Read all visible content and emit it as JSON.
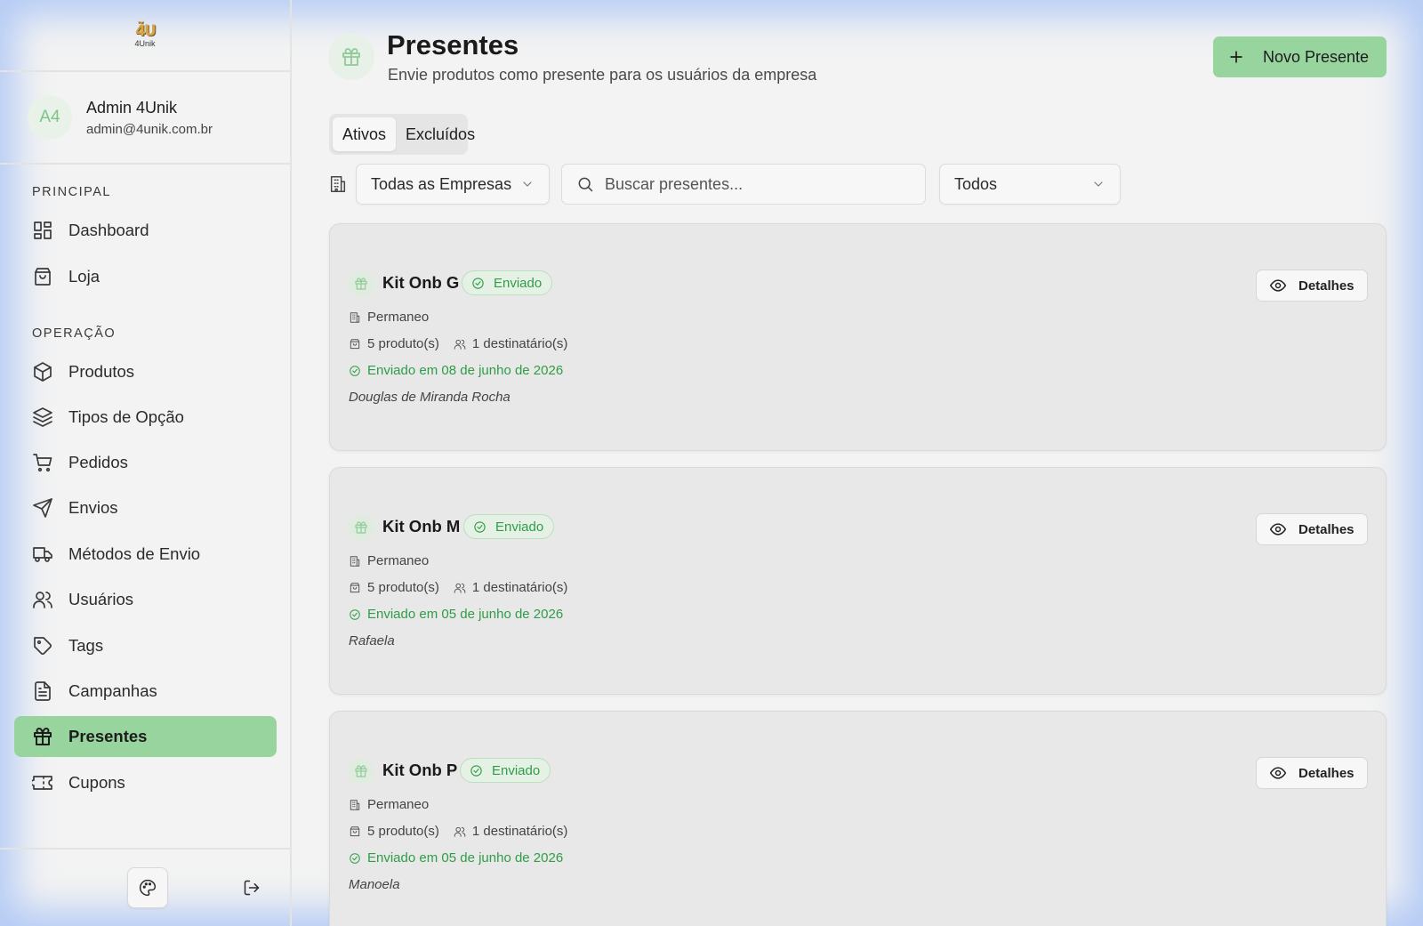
{
  "brand": {
    "logo_mark": "4́U",
    "logo_text": "4Unik"
  },
  "user": {
    "initials": "A4",
    "name": "Admin 4Unik",
    "email": "admin@4unik.com.br"
  },
  "sidebar": {
    "sections": [
      {
        "title": "PRINCIPAL",
        "items": [
          {
            "label": "Dashboard",
            "icon": "dashboard-icon"
          },
          {
            "label": "Loja",
            "icon": "shopping-bag-icon"
          }
        ]
      },
      {
        "title": "OPERAÇÃO",
        "items": [
          {
            "label": "Produtos",
            "icon": "box-icon"
          },
          {
            "label": "Tipos de Opção",
            "icon": "layers-icon"
          },
          {
            "label": "Pedidos",
            "icon": "cart-icon"
          },
          {
            "label": "Envios",
            "icon": "send-icon"
          },
          {
            "label": "Métodos de Envio",
            "icon": "truck-icon"
          },
          {
            "label": "Usuários",
            "icon": "users-icon"
          },
          {
            "label": "Tags",
            "icon": "tag-icon"
          },
          {
            "label": "Campanhas",
            "icon": "document-icon"
          },
          {
            "label": "Presentes",
            "icon": "gift-icon",
            "active": true
          },
          {
            "label": "Cupons",
            "icon": "ticket-icon"
          }
        ]
      }
    ]
  },
  "header": {
    "title": "Presentes",
    "subtitle": "Envie produtos como presente para os usuários da empresa",
    "new_button": "Novo Presente"
  },
  "tabs": [
    {
      "label": "Ativos",
      "active": true
    },
    {
      "label": "Excluídos",
      "active": false
    }
  ],
  "filters": {
    "company_select": "Todas as Empresas",
    "search_placeholder": "Buscar presentes...",
    "status_select": "Todos"
  },
  "cards": [
    {
      "title": "Kit Onb G",
      "status": "Enviado",
      "company": "Permaneo",
      "products": "5 produto(s)",
      "recipients": "1 destinatário(s)",
      "sent": "Enviado em 08 de junho de 2026",
      "sender": "Douglas de Miranda Rocha",
      "details": "Detalhes"
    },
    {
      "title": "Kit Onb M",
      "status": "Enviado",
      "company": "Permaneo",
      "products": "5 produto(s)",
      "recipients": "1 destinatário(s)",
      "sent": "Enviado em 05 de junho de 2026",
      "sender": "Rafaela",
      "details": "Detalhes"
    },
    {
      "title": "Kit Onb P",
      "status": "Enviado",
      "company": "Permaneo",
      "products": "5 produto(s)",
      "recipients": "1 destinatário(s)",
      "sent": "Enviado em 05 de junho de 2026",
      "sender": "Manoela",
      "details": "Detalhes"
    }
  ],
  "colors": {
    "accent": "#98d49e",
    "success": "#2e9d47",
    "card_bg": "#e8e8e8"
  }
}
